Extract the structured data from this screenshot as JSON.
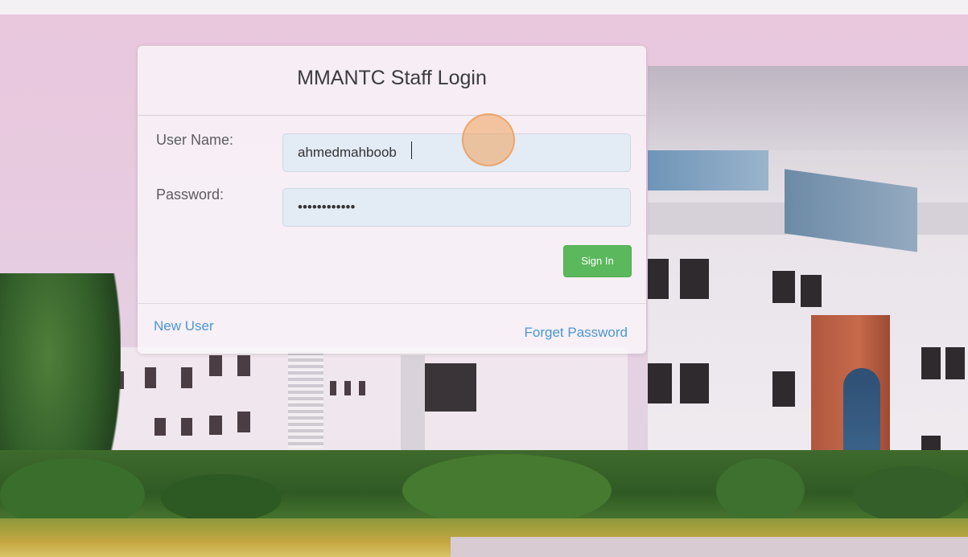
{
  "login": {
    "title": "MMANTC Staff Login",
    "username_label": "User Name:",
    "username_value": "ahmedmahboob",
    "password_label": "Password:",
    "password_value": "••••••••••••",
    "signin_label": "Sign In",
    "new_user_label": "New User",
    "forget_password_label": "Forget Password"
  },
  "colors": {
    "signin_button": "#5cb85c",
    "link": "#4b97d1",
    "input_background": "#e3ebf5",
    "touch_indicator": "#f0a05a"
  },
  "background": {
    "description_icon": "campus-building-photo"
  }
}
